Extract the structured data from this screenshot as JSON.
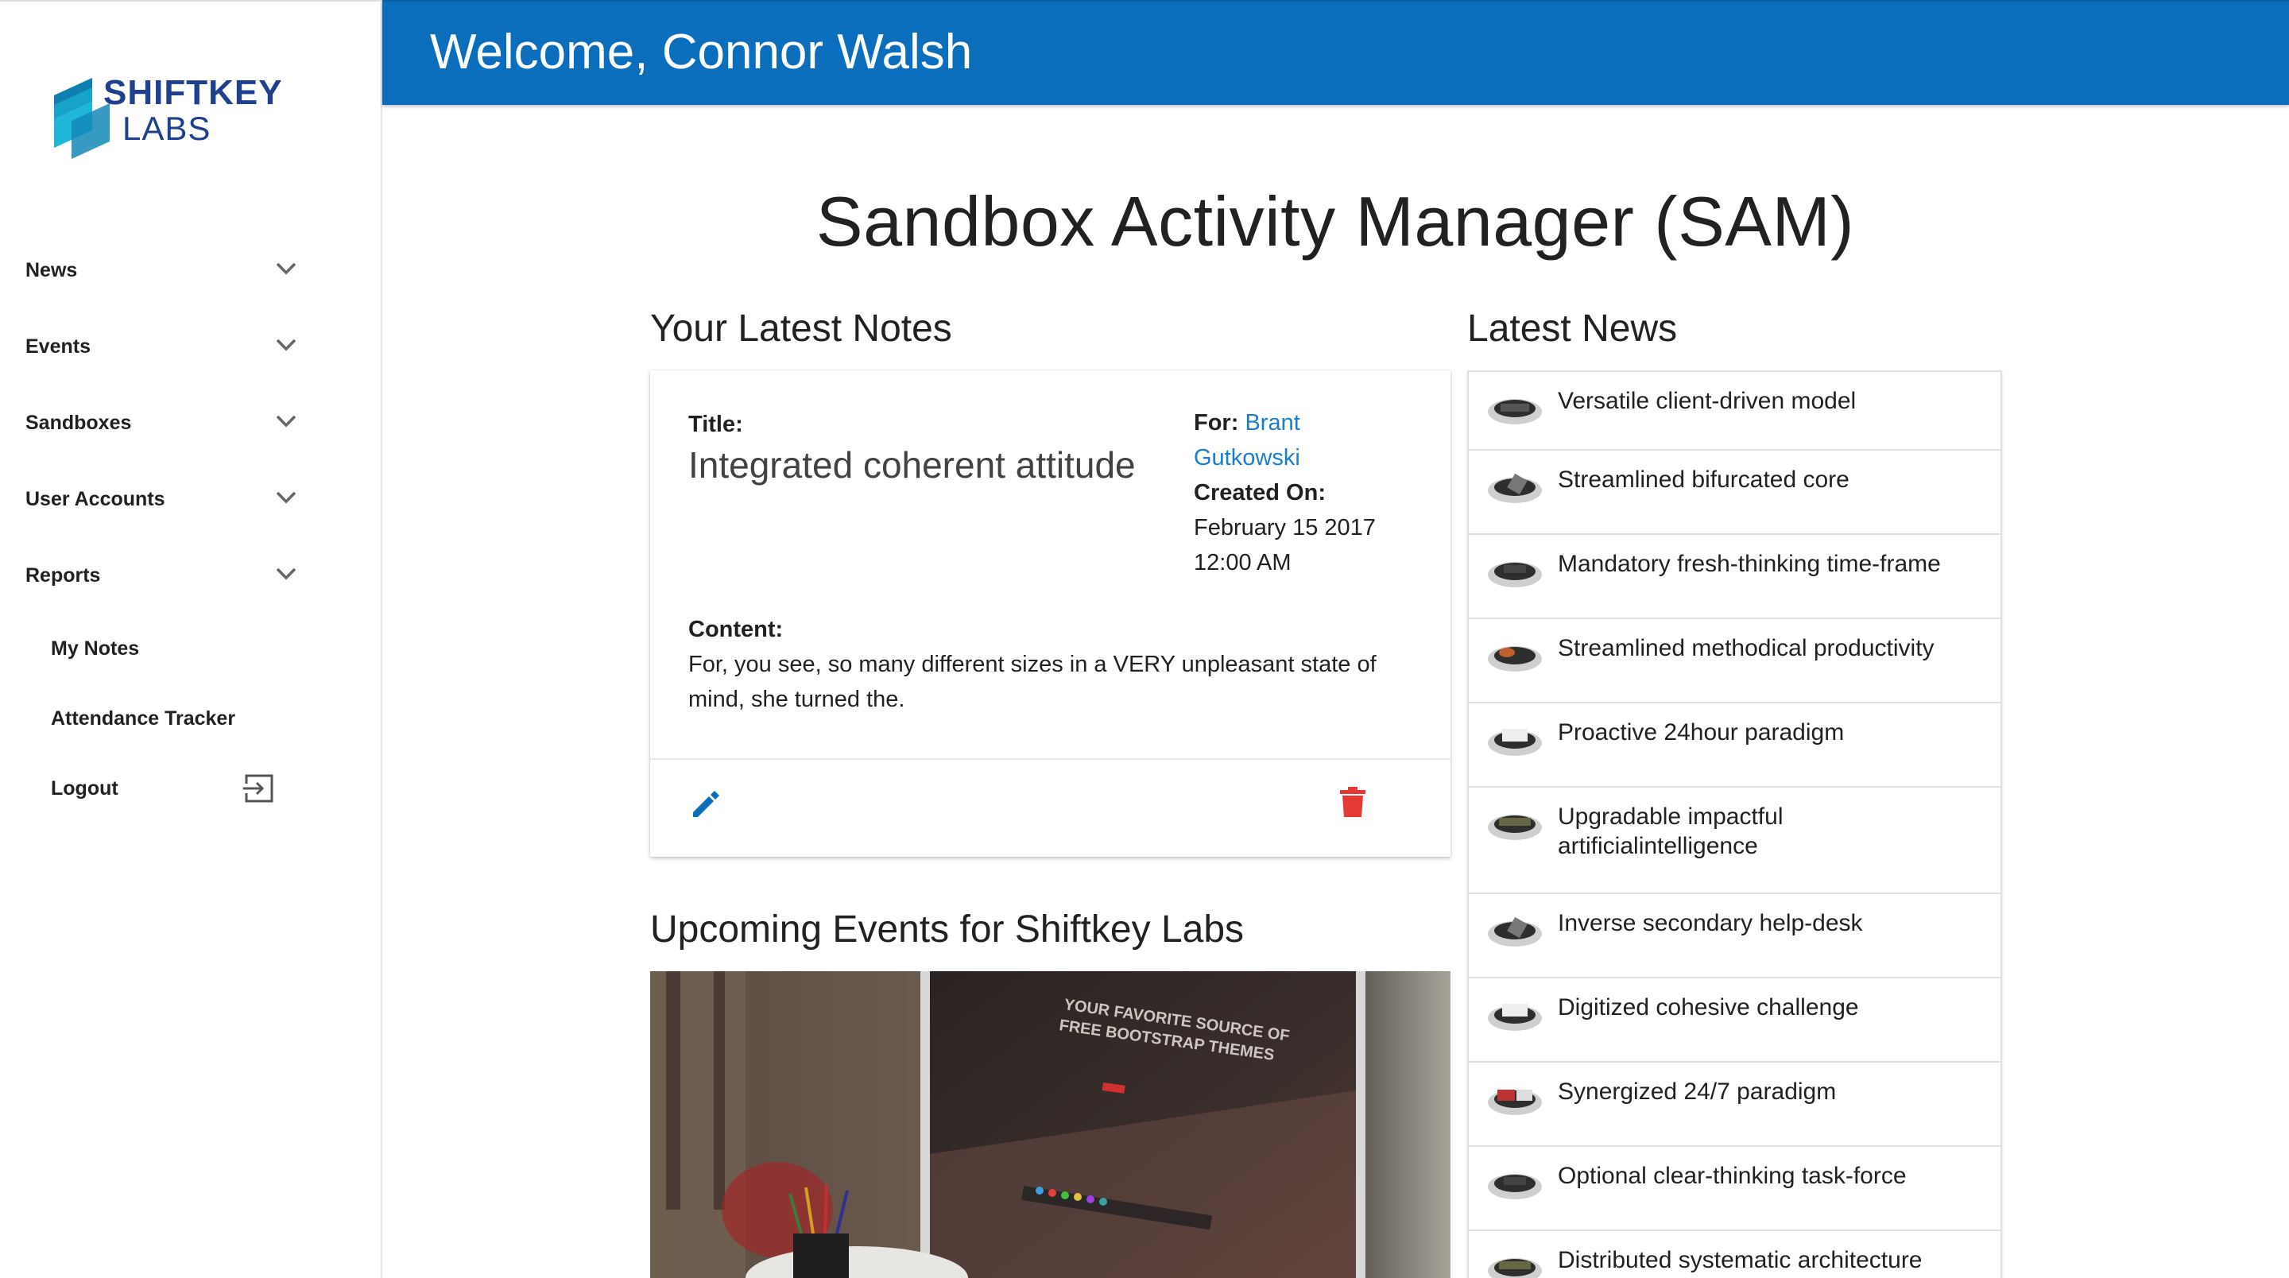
{
  "brand": {
    "line1": "SHIFTKEY",
    "line2": "LABS",
    "primary_color": "#0a6ebd",
    "logo_blue": "#1f3f8f",
    "logo_cyan": "#17a2c9"
  },
  "header": {
    "welcome": "Welcome, Connor Walsh"
  },
  "sidebar": {
    "items": [
      {
        "label": "News",
        "icon": "chevron-down-icon"
      },
      {
        "label": "Events",
        "icon": "chevron-down-icon"
      },
      {
        "label": "Sandboxes",
        "icon": "chevron-down-icon"
      },
      {
        "label": "User Accounts",
        "icon": "chevron-down-icon"
      },
      {
        "label": "Reports",
        "icon": "chevron-down-icon"
      }
    ],
    "sub_items": [
      {
        "label": "My Notes"
      },
      {
        "label": "Attendance Tracker"
      },
      {
        "label": "Logout",
        "icon": "logout-icon"
      }
    ]
  },
  "main": {
    "title": "Sandbox Activity Manager (SAM)",
    "notes_heading": "Your Latest Notes",
    "events_heading": "Upcoming Events for Shiftkey Labs",
    "news_heading": "Latest News"
  },
  "note": {
    "title_label": "Title:",
    "title_value": "Integrated coherent attitude",
    "for_label": "For:",
    "for_first": "Brant",
    "for_last": "Gutkowski",
    "created_label": "Created On:",
    "created_date": "February 15 2017",
    "created_time": "12:00 AM",
    "content_label": "Content:",
    "content_line1": "For, you see, so many different sizes in a VERY unpleasant state of",
    "content_line2": "mind, she turned the.",
    "link_color": "#1a7dd0",
    "delete_color": "#e53935"
  },
  "event_image": {
    "screen_line1": "YOUR FAVORITE SOURCE OF",
    "screen_line2": "FREE BOOTSTRAP THEMES"
  },
  "news": [
    {
      "line1": "Versatile client-driven model",
      "line2": ""
    },
    {
      "line1": "Streamlined bifurcated core",
      "line2": ""
    },
    {
      "line1": "Mandatory fresh-thinking time-frame",
      "line2": ""
    },
    {
      "line1": "Streamlined methodical productivity",
      "line2": ""
    },
    {
      "line1": "Proactive 24hour paradigm",
      "line2": ""
    },
    {
      "line1": "Upgradable impactful",
      "line2": "artificialintelligence"
    },
    {
      "line1": "Inverse secondary help-desk",
      "line2": ""
    },
    {
      "line1": "Digitized cohesive challenge",
      "line2": ""
    },
    {
      "line1": "Synergized 24/7 paradigm",
      "line2": ""
    },
    {
      "line1": "Optional clear-thinking task-force",
      "line2": ""
    },
    {
      "line1": "Distributed systematic architecture",
      "line2": ""
    }
  ]
}
